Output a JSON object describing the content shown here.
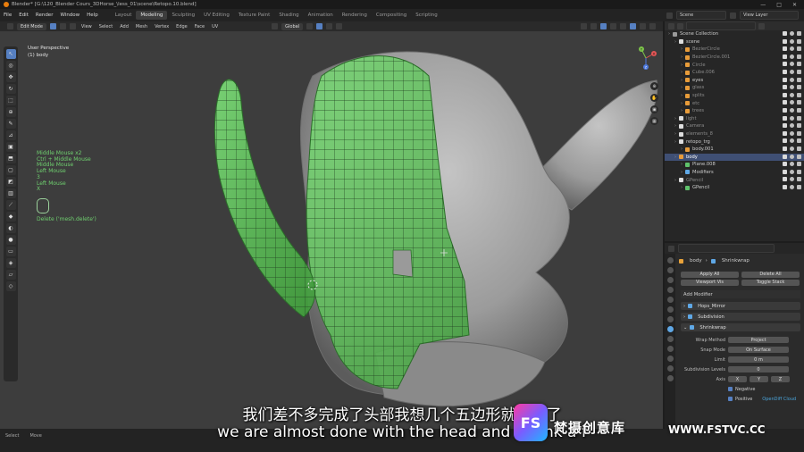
{
  "window": {
    "title": "Blender* [G:\\120_Blender Cours_3DHorse_\\less_01\\scene\\Retopo.10.blend]",
    "controls": [
      "—",
      "□",
      "✕"
    ]
  },
  "menu": {
    "items": [
      "File",
      "Edit",
      "Render",
      "Window",
      "Help"
    ],
    "workspaces": [
      "Layout",
      "Modeling",
      "Sculpting",
      "UV Editing",
      "Texture Paint",
      "Shading",
      "Animation",
      "Rendering",
      "Compositing",
      "Scripting"
    ],
    "active_workspace": "Modeling",
    "scene": "Scene",
    "view_layer": "View Layer"
  },
  "viewport_header": {
    "mode": "Edit Mode",
    "menus": [
      "View",
      "Select",
      "Add",
      "Mesh",
      "Vertex",
      "Edge",
      "Face",
      "UV"
    ],
    "orientation": "Global",
    "options": "Options"
  },
  "viewport": {
    "view_name": "User Perspective",
    "object_name": "(1) body",
    "key_log": [
      "Middle Mouse x2",
      "Ctrl + Middle Mouse",
      "Middle Mouse",
      "Left Mouse",
      "3",
      "Left Mouse",
      "X"
    ],
    "operator": "Delete ('mesh.delete')",
    "gizmo": {
      "x": "X",
      "y": "Y",
      "z": "Z"
    }
  },
  "outliner": {
    "header": "Scene Collection",
    "rows": [
      {
        "label": "Scene Collection",
        "indent": 0,
        "dim": false
      },
      {
        "label": "scene",
        "indent": 1,
        "dim": false
      },
      {
        "label": "BezierCircle",
        "indent": 2,
        "dim": true
      },
      {
        "label": "BezierCircle.001",
        "indent": 2,
        "dim": true
      },
      {
        "label": "Circle",
        "indent": 2,
        "dim": true
      },
      {
        "label": "Cube.006",
        "indent": 2,
        "dim": true
      },
      {
        "label": "eyes",
        "indent": 2,
        "dim": false
      },
      {
        "label": "glass",
        "indent": 2,
        "dim": true
      },
      {
        "label": "splits",
        "indent": 2,
        "dim": true
      },
      {
        "label": "etc",
        "indent": 2,
        "dim": true
      },
      {
        "label": "trees",
        "indent": 2,
        "dim": true
      },
      {
        "label": "light",
        "indent": 1,
        "dim": true
      },
      {
        "label": "Camera",
        "indent": 1,
        "dim": true
      },
      {
        "label": "elements_8",
        "indent": 1,
        "dim": true
      },
      {
        "label": "retopo_trg",
        "indent": 1,
        "dim": false
      },
      {
        "label": "body.001",
        "indent": 2,
        "dim": false
      },
      {
        "label": "body",
        "indent": 1,
        "dim": false,
        "selected": true
      },
      {
        "label": "Plane.008",
        "indent": 2,
        "dim": false
      },
      {
        "label": "Modifiers",
        "indent": 2,
        "dim": false
      },
      {
        "label": "GPencil",
        "indent": 1,
        "dim": true
      },
      {
        "label": "GPencil",
        "indent": 2,
        "dim": false
      }
    ]
  },
  "properties": {
    "breadcrumb": [
      "body",
      "Shrinkwrap"
    ],
    "apply_all": "Apply All",
    "delete_all": "Delete All",
    "viewport_vis": "Viewport Vis",
    "toggle_stack": "Toggle Stack",
    "add_modifier": "Add Modifier",
    "modifiers": [
      "Hops_Mirror",
      "Subdivision",
      "Shrinkwrap"
    ],
    "fields": [
      {
        "label": "Wrap Method",
        "value": "Project"
      },
      {
        "label": "Snap Mode",
        "value": "On Surface"
      },
      {
        "label": "Limit",
        "value": "0 m"
      },
      {
        "label": "Subdivision Levels",
        "value": "0"
      }
    ],
    "axis_label": "Axis",
    "axes": [
      "X",
      "Y",
      "Z"
    ],
    "negative": "Negative",
    "positive": "Positive",
    "cloud": "OpenDiff Cloud"
  },
  "status": {
    "items": [
      "Select",
      "Move"
    ]
  },
  "subtitles": {
    "zh": "我们差不多完成了头部我想几个五边形就可以了",
    "en": "we are almost done with the head and i think a f"
  },
  "watermark": {
    "logo": "FS",
    "zh": "梵摄创意库",
    "url": "WWW.FSTVC.CC"
  },
  "colors": {
    "accent": "#5680c2",
    "mesh_green": "#56c94e",
    "model_gray": "#9a9a9a",
    "viewport_bg": "#3d3d3d"
  }
}
